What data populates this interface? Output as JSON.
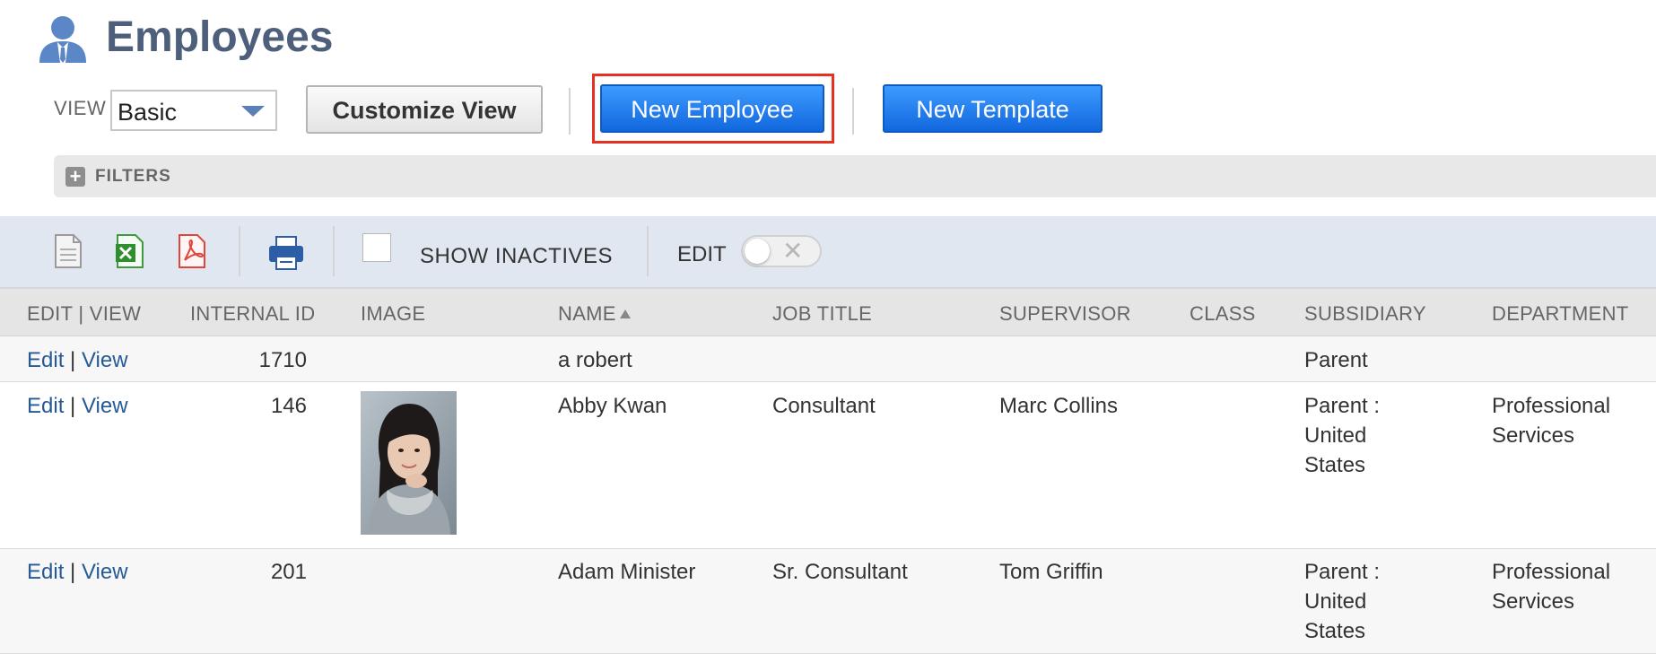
{
  "page": {
    "title": "Employees",
    "title_icon": "person-icon"
  },
  "toolbar": {
    "view_label": "VIEW",
    "view_selected": "Basic",
    "customize_label": "Customize View",
    "new_employee_label": "New Employee",
    "new_template_label": "New Template",
    "highlight_color": "#e53124"
  },
  "filters": {
    "label": "FILTERS"
  },
  "list_toolbar": {
    "icons": [
      "document-icon",
      "excel-icon",
      "pdf-icon",
      "print-icon"
    ],
    "show_inactives_label": "SHOW INACTIVES",
    "show_inactives_checked": false,
    "edit_label": "EDIT",
    "edit_toggle_on": false
  },
  "table": {
    "columns": [
      "EDIT | VIEW",
      "INTERNAL ID",
      "IMAGE",
      "NAME",
      "JOB TITLE",
      "SUPERVISOR",
      "CLASS",
      "SUBSIDIARY",
      "DEPARTMENT"
    ],
    "sorted_column": "NAME",
    "edit_link": "Edit",
    "view_link": "View",
    "link_separator": "|",
    "rows": [
      {
        "id": "1710",
        "name": "a robert",
        "job_title": "",
        "supervisor": "",
        "class": "",
        "subsidiary": [
          "Parent"
        ],
        "department": [],
        "has_image": false
      },
      {
        "id": "146",
        "name": "Abby Kwan",
        "job_title": "Consultant",
        "supervisor": "Marc Collins",
        "class": "",
        "subsidiary": [
          "Parent :",
          "United",
          "States"
        ],
        "department": [
          "Professional",
          "Services"
        ],
        "has_image": true
      },
      {
        "id": "201",
        "name": "Adam Minister",
        "job_title": "Sr. Consultant",
        "supervisor": "Tom Griffin",
        "class": "",
        "subsidiary": [
          "Parent :",
          "United",
          "States"
        ],
        "department": [
          "Professional",
          "Services"
        ],
        "has_image": false
      }
    ]
  }
}
